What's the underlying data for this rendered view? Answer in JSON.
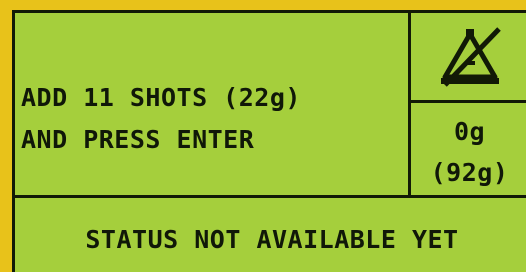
{
  "display": {
    "instruction_line_1": "ADD 11 SHOTS (22g)",
    "instruction_line_2": "AND PRESS ENTER",
    "current_weight": "0g",
    "target_weight": "(92g)",
    "status": "STATUS NOT AVAILABLE YET",
    "warning_icon": "crossed-out-weight-warning-icon"
  },
  "colors": {
    "lcd_background": "#a5cf3c",
    "frame": "#e8c21a",
    "ink": "#121a06"
  }
}
